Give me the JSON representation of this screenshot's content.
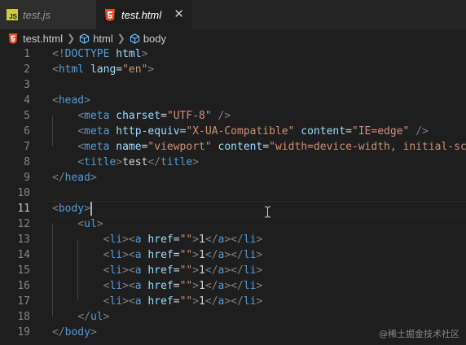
{
  "tabs": [
    {
      "label": "test.js",
      "icon": "js-file-icon",
      "active": false
    },
    {
      "label": "test.html",
      "icon": "html5-file-icon",
      "active": true
    }
  ],
  "js_icon_text": "JS",
  "close_icon": "close-icon",
  "breadcrumb": {
    "file": "test.html",
    "items": [
      "html",
      "body"
    ]
  },
  "cursor_line": 11,
  "code_lines": [
    {
      "n": "1",
      "tokens": [
        [
          "p",
          "<!"
        ],
        [
          "t",
          "DOCTYPE"
        ],
        [
          "x",
          " "
        ],
        [
          "a",
          "html"
        ],
        [
          "p",
          ">"
        ]
      ]
    },
    {
      "n": "2",
      "tokens": [
        [
          "p",
          "<"
        ],
        [
          "t",
          "html"
        ],
        [
          "x",
          " "
        ],
        [
          "a",
          "lang"
        ],
        [
          "x",
          "="
        ],
        [
          "s",
          "\"en\""
        ],
        [
          "p",
          ">"
        ]
      ]
    },
    {
      "n": "3",
      "tokens": []
    },
    {
      "n": "4",
      "tokens": [
        [
          "p",
          "<"
        ],
        [
          "t",
          "head"
        ],
        [
          "p",
          ">"
        ]
      ]
    },
    {
      "n": "5",
      "tokens": [
        [
          "x",
          "    "
        ],
        [
          "p",
          "<"
        ],
        [
          "t",
          "meta"
        ],
        [
          "x",
          " "
        ],
        [
          "a",
          "charset"
        ],
        [
          "x",
          "="
        ],
        [
          "s",
          "\"UTF-8\""
        ],
        [
          "x",
          " "
        ],
        [
          "p",
          "/>"
        ]
      ]
    },
    {
      "n": "6",
      "tokens": [
        [
          "x",
          "    "
        ],
        [
          "p",
          "<"
        ],
        [
          "t",
          "meta"
        ],
        [
          "x",
          " "
        ],
        [
          "a",
          "http-equiv"
        ],
        [
          "x",
          "="
        ],
        [
          "s",
          "\"X-UA-Compatible\""
        ],
        [
          "x",
          " "
        ],
        [
          "a",
          "content"
        ],
        [
          "x",
          "="
        ],
        [
          "s",
          "\"IE=edge\""
        ],
        [
          "x",
          " "
        ],
        [
          "p",
          "/>"
        ]
      ]
    },
    {
      "n": "7",
      "tokens": [
        [
          "x",
          "    "
        ],
        [
          "p",
          "<"
        ],
        [
          "t",
          "meta"
        ],
        [
          "x",
          " "
        ],
        [
          "a",
          "name"
        ],
        [
          "x",
          "="
        ],
        [
          "s",
          "\"viewport\""
        ],
        [
          "x",
          " "
        ],
        [
          "a",
          "content"
        ],
        [
          "x",
          "="
        ],
        [
          "s",
          "\"width=device-width, initial-sca"
        ]
      ]
    },
    {
      "n": "8",
      "tokens": [
        [
          "x",
          "    "
        ],
        [
          "p",
          "<"
        ],
        [
          "t",
          "title"
        ],
        [
          "p",
          ">"
        ],
        [
          "x",
          "test"
        ],
        [
          "p",
          "</"
        ],
        [
          "t",
          "title"
        ],
        [
          "p",
          ">"
        ]
      ]
    },
    {
      "n": "9",
      "tokens": [
        [
          "p",
          "</"
        ],
        [
          "t",
          "head"
        ],
        [
          "p",
          ">"
        ]
      ]
    },
    {
      "n": "10",
      "tokens": []
    },
    {
      "n": "11",
      "tokens": [
        [
          "p",
          "<"
        ],
        [
          "t",
          "body"
        ],
        [
          "p",
          ">"
        ]
      ]
    },
    {
      "n": "12",
      "tokens": [
        [
          "x",
          "    "
        ],
        [
          "p",
          "<"
        ],
        [
          "t",
          "ul"
        ],
        [
          "p",
          ">"
        ]
      ]
    },
    {
      "n": "13",
      "tokens": [
        [
          "x",
          "        "
        ],
        [
          "p",
          "<"
        ],
        [
          "t",
          "li"
        ],
        [
          "p",
          "><"
        ],
        [
          "t",
          "a"
        ],
        [
          "x",
          " "
        ],
        [
          "a",
          "href"
        ],
        [
          "x",
          "="
        ],
        [
          "s",
          "\"\""
        ],
        [
          "p",
          ">"
        ],
        [
          "x",
          "1"
        ],
        [
          "p",
          "</"
        ],
        [
          "t",
          "a"
        ],
        [
          "p",
          "></"
        ],
        [
          "t",
          "li"
        ],
        [
          "p",
          ">"
        ]
      ]
    },
    {
      "n": "14",
      "tokens": [
        [
          "x",
          "        "
        ],
        [
          "p",
          "<"
        ],
        [
          "t",
          "li"
        ],
        [
          "p",
          "><"
        ],
        [
          "t",
          "a"
        ],
        [
          "x",
          " "
        ],
        [
          "a",
          "href"
        ],
        [
          "x",
          "="
        ],
        [
          "s",
          "\"\""
        ],
        [
          "p",
          ">"
        ],
        [
          "x",
          "1"
        ],
        [
          "p",
          "</"
        ],
        [
          "t",
          "a"
        ],
        [
          "p",
          "></"
        ],
        [
          "t",
          "li"
        ],
        [
          "p",
          ">"
        ]
      ]
    },
    {
      "n": "15",
      "tokens": [
        [
          "x",
          "        "
        ],
        [
          "p",
          "<"
        ],
        [
          "t",
          "li"
        ],
        [
          "p",
          "><"
        ],
        [
          "t",
          "a"
        ],
        [
          "x",
          " "
        ],
        [
          "a",
          "href"
        ],
        [
          "x",
          "="
        ],
        [
          "s",
          "\"\""
        ],
        [
          "p",
          ">"
        ],
        [
          "x",
          "1"
        ],
        [
          "p",
          "</"
        ],
        [
          "t",
          "a"
        ],
        [
          "p",
          "></"
        ],
        [
          "t",
          "li"
        ],
        [
          "p",
          ">"
        ]
      ]
    },
    {
      "n": "16",
      "tokens": [
        [
          "x",
          "        "
        ],
        [
          "p",
          "<"
        ],
        [
          "t",
          "li"
        ],
        [
          "p",
          "><"
        ],
        [
          "t",
          "a"
        ],
        [
          "x",
          " "
        ],
        [
          "a",
          "href"
        ],
        [
          "x",
          "="
        ],
        [
          "s",
          "\"\""
        ],
        [
          "p",
          ">"
        ],
        [
          "x",
          "1"
        ],
        [
          "p",
          "</"
        ],
        [
          "t",
          "a"
        ],
        [
          "p",
          "></"
        ],
        [
          "t",
          "li"
        ],
        [
          "p",
          ">"
        ]
      ]
    },
    {
      "n": "17",
      "tokens": [
        [
          "x",
          "        "
        ],
        [
          "p",
          "<"
        ],
        [
          "t",
          "li"
        ],
        [
          "p",
          "><"
        ],
        [
          "t",
          "a"
        ],
        [
          "x",
          " "
        ],
        [
          "a",
          "href"
        ],
        [
          "x",
          "="
        ],
        [
          "s",
          "\"\""
        ],
        [
          "p",
          ">"
        ],
        [
          "x",
          "1"
        ],
        [
          "p",
          "</"
        ],
        [
          "t",
          "a"
        ],
        [
          "p",
          "></"
        ],
        [
          "t",
          "li"
        ],
        [
          "p",
          ">"
        ]
      ]
    },
    {
      "n": "18",
      "tokens": [
        [
          "x",
          "    "
        ],
        [
          "p",
          "</"
        ],
        [
          "t",
          "ul"
        ],
        [
          "p",
          ">"
        ]
      ]
    },
    {
      "n": "19",
      "tokens": [
        [
          "p",
          "</"
        ],
        [
          "t",
          "body"
        ],
        [
          "p",
          ">"
        ]
      ]
    }
  ],
  "watermark": "@稀土掘金技术社区",
  "colors": {
    "tag": "#569cd6",
    "attr": "#9cdcfe",
    "string": "#ce9178",
    "punct": "#808080",
    "text": "#d4d4d4",
    "bg": "#1e1e1e"
  }
}
